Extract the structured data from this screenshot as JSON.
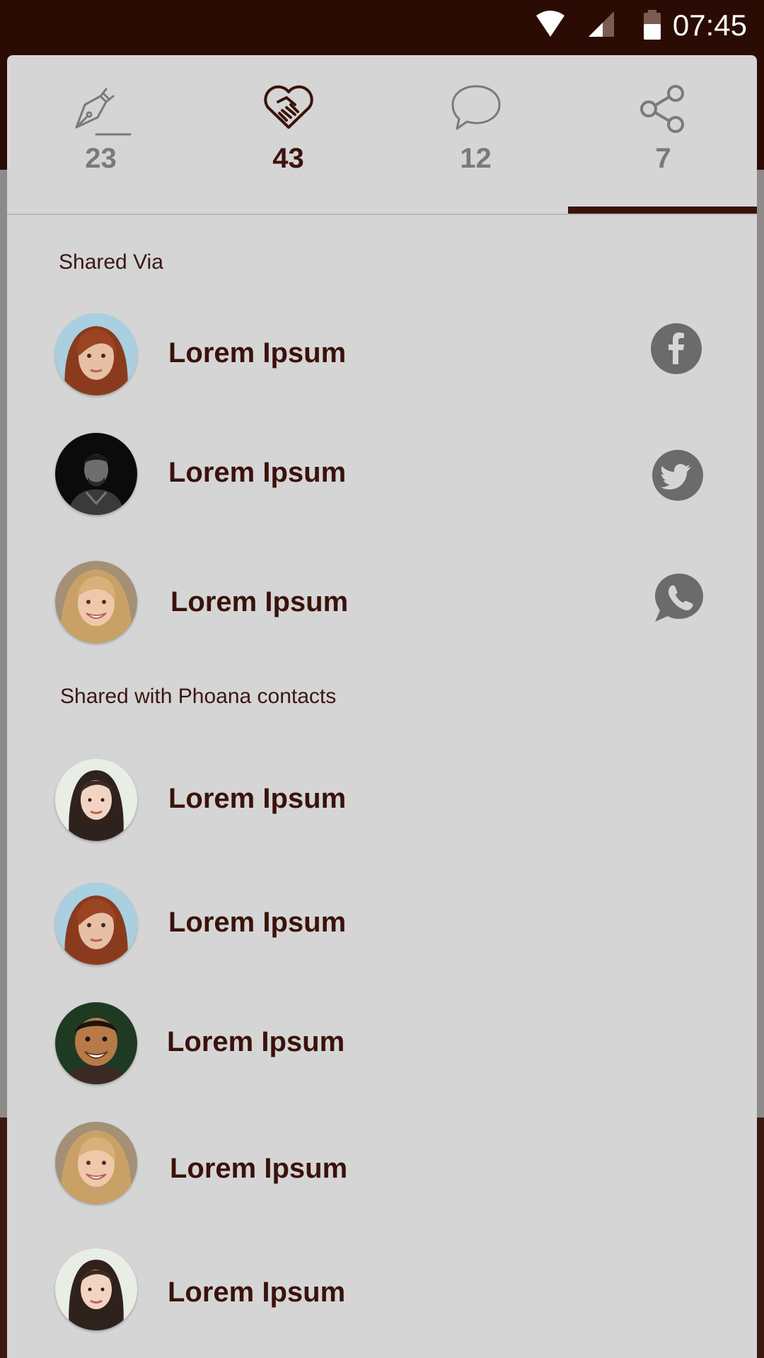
{
  "status_bar": {
    "time": "07:45",
    "icons": [
      "wifi-icon",
      "signal-icon",
      "battery-icon"
    ]
  },
  "tabs": [
    {
      "icon": "pen-icon",
      "count": "23"
    },
    {
      "icon": "handshake-heart-icon",
      "count": "43"
    },
    {
      "icon": "comment-icon",
      "count": "12"
    },
    {
      "icon": "share-icon",
      "count": "7",
      "selected": true
    }
  ],
  "sections": {
    "shared_via": {
      "title": "Shared Via",
      "items": [
        {
          "name": "Lorem Ipsum",
          "avatar": "avatar-redhead-woman",
          "network": "facebook-icon"
        },
        {
          "name": "Lorem Ipsum",
          "avatar": "avatar-man-dark",
          "network": "twitter-icon"
        },
        {
          "name": "Lorem Ipsum",
          "avatar": "avatar-blonde-woman",
          "network": "whatsapp-icon"
        }
      ]
    },
    "shared_with": {
      "title": "Shared with Phoana contacts",
      "items": [
        {
          "name": "Lorem Ipsum",
          "avatar": "avatar-asian-woman"
        },
        {
          "name": "Lorem Ipsum",
          "avatar": "avatar-redhead-woman"
        },
        {
          "name": "Lorem Ipsum",
          "avatar": "avatar-smiling-man"
        },
        {
          "name": "Lorem Ipsum",
          "avatar": "avatar-blonde-woman"
        },
        {
          "name": "Lorem Ipsum",
          "avatar": "avatar-asian-woman"
        }
      ]
    }
  },
  "colors": {
    "accent": "#3a120a",
    "sheet": "#d5d5d6",
    "statusbar": "#2a0c04",
    "muted": "#7b7a7a"
  }
}
